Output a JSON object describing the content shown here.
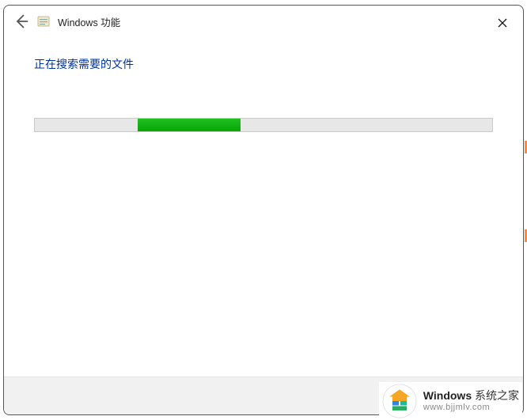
{
  "window": {
    "title": "Windows 功能",
    "icons": {
      "back": "back-arrow-icon",
      "app": "windows-features-icon",
      "close": "close-icon"
    }
  },
  "status": {
    "message": "正在搜索需要的文件"
  },
  "progress": {
    "indeterminate": true,
    "chunk_left_pct": 22.5,
    "chunk_width_pct": 22.5
  },
  "watermark": {
    "brand_prefix": "Windows",
    "brand_suffix": " 系统之家",
    "url": "www.bjjmlv.com",
    "logo_colors": {
      "roof": "#f5a623",
      "left": "#2e86de",
      "right": "#1abc9c",
      "bottom": "#27ae60"
    }
  }
}
